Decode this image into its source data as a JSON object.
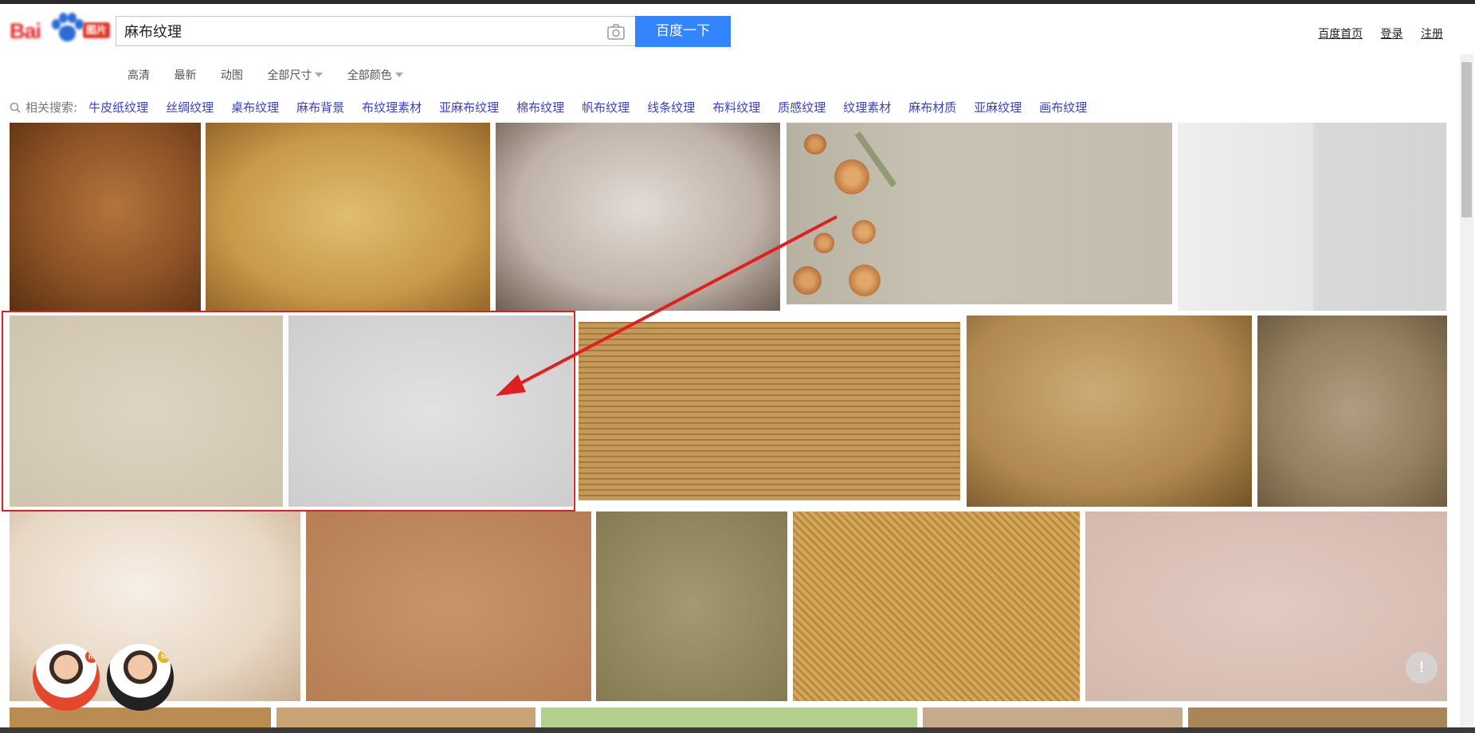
{
  "search": {
    "query": "麻布纹理",
    "button_label": "百度一下"
  },
  "top_links": [
    "百度首页",
    "登录",
    "注册"
  ],
  "filters": [
    {
      "label": "高清",
      "dropdown": false
    },
    {
      "label": "最新",
      "dropdown": false
    },
    {
      "label": "动图",
      "dropdown": false
    },
    {
      "label": "全部尺寸",
      "dropdown": true
    },
    {
      "label": "全部颜色",
      "dropdown": true
    }
  ],
  "related": {
    "label": "相关搜索:",
    "items": [
      "牛皮纸纹理",
      "丝绸纹理",
      "桌布纹理",
      "麻布背景",
      "布纹理素材",
      "亚麻布纹理",
      "棉布纹理",
      "帆布纹理",
      "线条纹理",
      "布料纹理",
      "质感纹理",
      "纹理素材",
      "麻布材质",
      "亚麻纹理",
      "画布纹理"
    ]
  },
  "avatar_badges": [
    "hi",
    "hi"
  ],
  "feedback_symbol": "!",
  "colors": {
    "accent": "#3385ff",
    "related_link": "#3b3fc4",
    "highlight": "#e02020"
  }
}
